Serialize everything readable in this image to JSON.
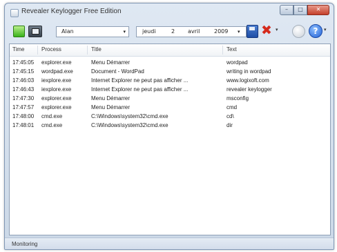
{
  "window": {
    "title": "Revealer Keylogger Free Edition",
    "min_glyph": "–",
    "max_glyph": "□",
    "close_glyph": "✕"
  },
  "toolbar": {
    "user": "Alan",
    "date_day_name": "jeudi",
    "date_day": "2",
    "date_month": "avril",
    "date_year": "2009",
    "dropdown_glyph": "▾",
    "delete_glyph": "✖",
    "help_glyph": "?"
  },
  "table": {
    "columns": [
      "Time",
      "Process",
      "Title",
      "Text"
    ],
    "rows": [
      [
        "17:45:05",
        "explorer.exe",
        "Menu Démarrer",
        "wordpad"
      ],
      [
        "17:45:15",
        "wordpad.exe",
        "Document - WordPad",
        "writing in wordpad"
      ],
      [
        "17:46:03",
        "iexplore.exe",
        "Internet Explorer ne peut pas afficher ...",
        "www.logixoft.com"
      ],
      [
        "17:46:43",
        "iexplore.exe",
        "Internet Explorer ne peut pas afficher ...",
        "revealer keylogger"
      ],
      [
        "17:47:30",
        "explorer.exe",
        "Menu Démarrer",
        "msconfig"
      ],
      [
        "17:47:57",
        "explorer.exe",
        "Menu Démarrer",
        "cmd"
      ],
      [
        "17:48:00",
        "cmd.exe",
        "C:\\Windows\\system32\\cmd.exe",
        "cd\\"
      ],
      [
        "17:48:01",
        "cmd.exe",
        "C:\\Windows\\system32\\cmd.exe",
        "dir"
      ]
    ]
  },
  "status": {
    "text": "Monitoring"
  },
  "icons": {
    "app": "keylogger-app-icon",
    "start": "start-monitoring-icon",
    "screenshot": "screenshot-viewer-icon",
    "save": "save-icon",
    "delete": "delete-icon",
    "options": "options-icon",
    "help": "help-icon"
  }
}
